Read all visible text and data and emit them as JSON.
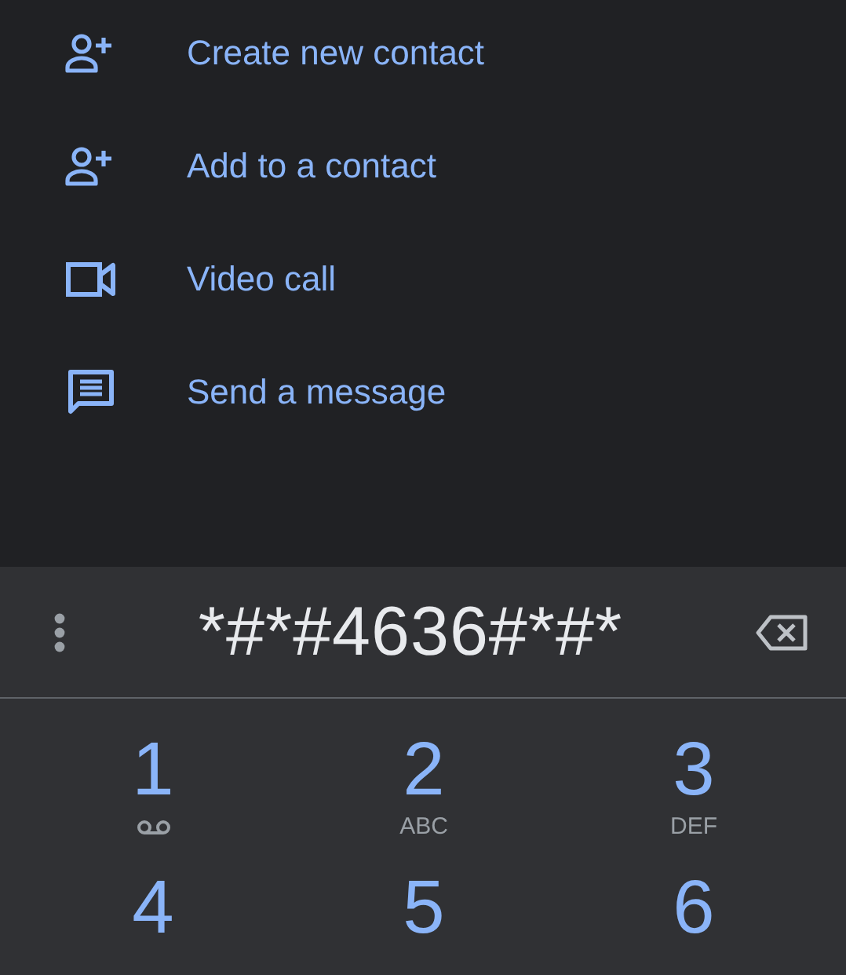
{
  "actions": [
    {
      "kind": "add-person",
      "label": "Create new contact"
    },
    {
      "kind": "add-person",
      "label": "Add to a contact"
    },
    {
      "kind": "video",
      "label": "Video call"
    },
    {
      "kind": "message",
      "label": "Send a message"
    }
  ],
  "dialer": {
    "number": "*#*#4636#*#*",
    "keys": [
      {
        "digit": "1",
        "kind": "voicemail"
      },
      {
        "digit": "2",
        "kind": "letters",
        "letters": "ABC"
      },
      {
        "digit": "3",
        "kind": "letters",
        "letters": "DEF"
      },
      {
        "digit": "4",
        "kind": "plain"
      },
      {
        "digit": "5",
        "kind": "plain"
      },
      {
        "digit": "6",
        "kind": "plain"
      }
    ]
  }
}
